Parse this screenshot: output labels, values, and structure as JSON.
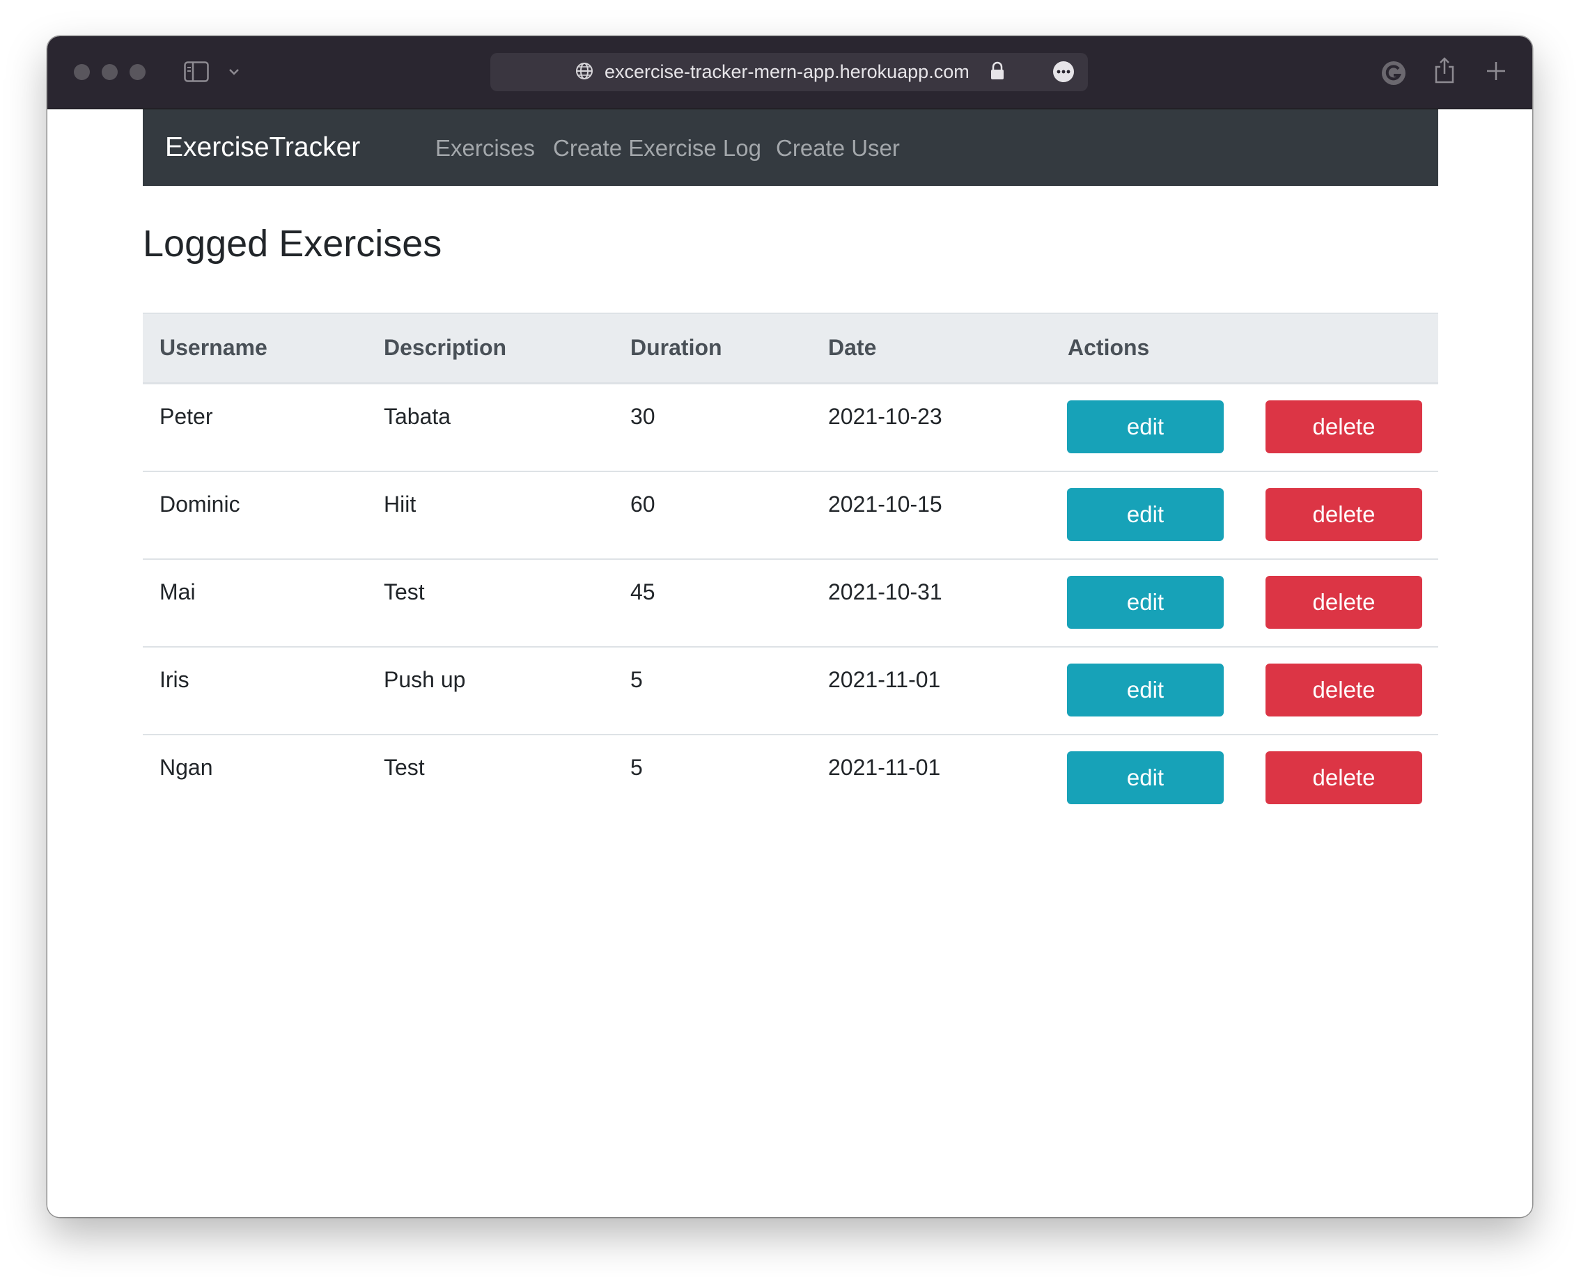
{
  "browser": {
    "url": "excercise-tracker-mern-app.herokuapp.com"
  },
  "navbar": {
    "brand": "ExerciseTracker",
    "links": [
      "Exercises",
      "Create Exercise Log",
      "Create User"
    ]
  },
  "page": {
    "title": "Logged Exercises"
  },
  "table": {
    "headers": [
      "Username",
      "Description",
      "Duration",
      "Date",
      "Actions"
    ],
    "rows": [
      {
        "username": "Peter",
        "description": "Tabata",
        "duration": "30",
        "date": "2021-10-23"
      },
      {
        "username": "Dominic",
        "description": "Hiit",
        "duration": "60",
        "date": "2021-10-15"
      },
      {
        "username": "Mai",
        "description": "Test",
        "duration": "45",
        "date": "2021-10-31"
      },
      {
        "username": "Iris",
        "description": "Push up",
        "duration": "5",
        "date": "2021-11-01"
      },
      {
        "username": "Ngan",
        "description": "Test",
        "duration": "5",
        "date": "2021-11-01"
      }
    ],
    "edit_label": "edit",
    "delete_label": "delete"
  },
  "colors": {
    "navbar_bg": "#343a40",
    "edit_button": "#17a2b8",
    "delete_button": "#dc3545",
    "table_header_bg": "#e9ecef"
  }
}
